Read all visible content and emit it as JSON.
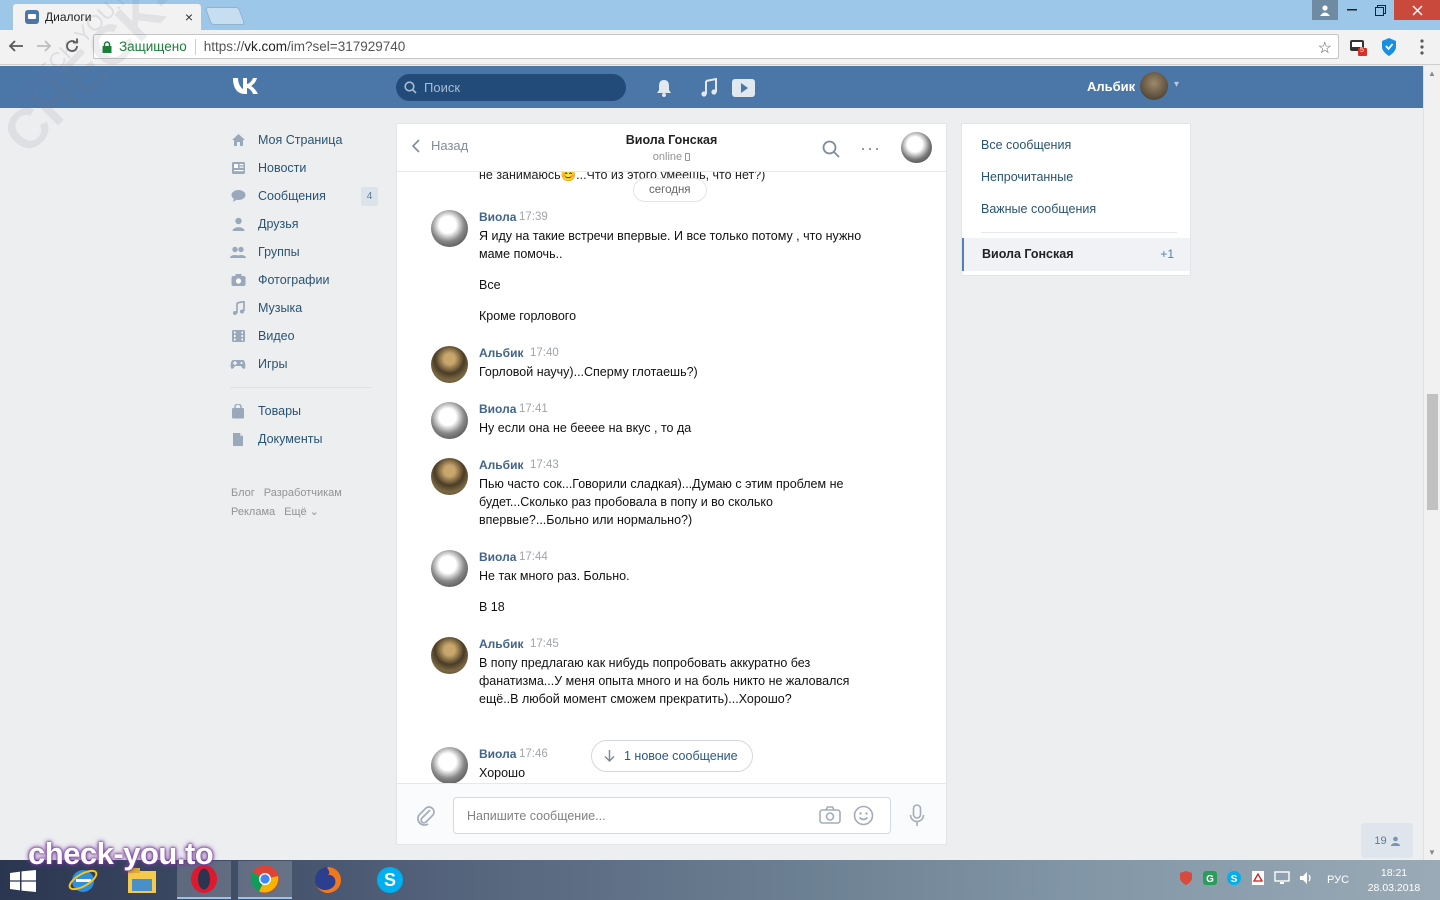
{
  "browser": {
    "tab_title": "Диалоги",
    "tab_close": "×",
    "secure_label": "Защищено",
    "url_scheme": "https://",
    "url_host": "vk.com",
    "url_path": "/im?sel=317929740",
    "ext_badge": "5"
  },
  "vk_header": {
    "logo": "ВК",
    "search_placeholder": "Поиск",
    "user_name": "Альбик"
  },
  "left_menu": {
    "items": [
      {
        "label": "Моя Страница",
        "icon": "home-icon"
      },
      {
        "label": "Новости",
        "icon": "news-icon"
      },
      {
        "label": "Сообщения",
        "icon": "messages-icon",
        "count": "4"
      },
      {
        "label": "Друзья",
        "icon": "friends-icon"
      },
      {
        "label": "Группы",
        "icon": "groups-icon"
      },
      {
        "label": "Фотографии",
        "icon": "camera-icon"
      },
      {
        "label": "Музыка",
        "icon": "music-icon"
      },
      {
        "label": "Видео",
        "icon": "video-icon"
      },
      {
        "label": "Игры",
        "icon": "games-icon"
      }
    ],
    "items2": [
      {
        "label": "Товары",
        "icon": "bag-icon"
      },
      {
        "label": "Документы",
        "icon": "document-icon"
      }
    ],
    "footer": [
      "Блог",
      "Разработчикам",
      "Реклама",
      "Ещё ⌄"
    ]
  },
  "dialog": {
    "back_label": "Назад",
    "peer_name": "Виола Гонская",
    "peer_status": "online",
    "top_clipped_text": "не занимаюсь😊...Что из этого умеешь, что нет?)",
    "date_divider": "сегодня",
    "messages": [
      {
        "author": "Виола",
        "time": "17:39",
        "lines": [
          "Я иду на такие встречи впервые. И все только потому , что нужно маме помочь..",
          "Все",
          "Кроме горлового"
        ]
      },
      {
        "author": "Альбик",
        "time": "17:40",
        "lines": [
          "Горловой научу)...Сперму глотаешь?)"
        ]
      },
      {
        "author": "Виола",
        "time": "17:41",
        "lines": [
          "Ну если она не бееее на вкус , то да"
        ]
      },
      {
        "author": "Альбик",
        "time": "17:43",
        "lines": [
          "Пью часто сок...Говорили сладкая)...Думаю с этим проблем не будет...Сколько раз пробовала в попу и во сколько впервые?...Больно или нормально?)"
        ]
      },
      {
        "author": "Виола",
        "time": "17:44",
        "lines": [
          "Не так много раз. Больно.",
          "В 18"
        ]
      },
      {
        "author": "Альбик",
        "time": "17:45",
        "lines": [
          "В попу предлагаю как нибудь попробовать аккуратно без фанатизма...У меня опыта много и на боль никто не жаловался ещё..В любой момент сможем прекратить)...Хорошо?"
        ]
      },
      {
        "author": "Виола",
        "time": "17:46",
        "lines": [
          "Хорошо"
        ]
      }
    ],
    "new_message_button": "1 новое сообщение",
    "compose_placeholder": "Напишите сообщение..."
  },
  "right_panel": {
    "all": "Все сообщения",
    "unread": "Непрочитанные",
    "important": "Важные сообщения",
    "selected_name": "Виола Гонская",
    "selected_count": "+1"
  },
  "online_widget": "19",
  "watermarks": {
    "big": "CHECK-YOU.ME",
    "small": "CHECK-YOU.ME",
    "bottom": "check-you.to"
  },
  "taskbar": {
    "lang": "РУС",
    "time": "18:21",
    "date": "28.03.2018"
  },
  "colors": {
    "vk_blue": "#4a76a8",
    "link": "#285473",
    "author": "#42648b"
  }
}
